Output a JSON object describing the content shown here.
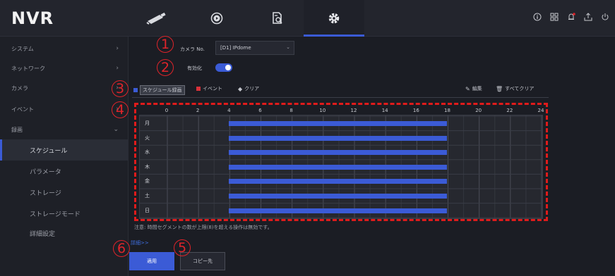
{
  "app": {
    "logo": "NVR"
  },
  "nav": {
    "tabs": [
      {
        "icon": "camera-icon"
      },
      {
        "icon": "playback-icon"
      },
      {
        "icon": "file-search-icon"
      },
      {
        "icon": "settings-gear-icon",
        "active": true
      }
    ],
    "right_icons": [
      "info-icon",
      "network-icon",
      "alarm-bell-icon",
      "export-icon",
      "power-icon"
    ]
  },
  "sidebar": {
    "items": [
      {
        "label": "システム",
        "chevron": "›"
      },
      {
        "label": "ネットワーク",
        "chevron": "›"
      },
      {
        "label": "カメラ",
        "chevron": "›"
      },
      {
        "label": "イベント",
        "chevron": "›"
      },
      {
        "label": "録画",
        "chevron": "⌄"
      }
    ],
    "subitems": [
      {
        "label": "スケジュール",
        "active": true
      },
      {
        "label": "パラメータ"
      },
      {
        "label": "ストレージ"
      },
      {
        "label": "ストレージモード"
      },
      {
        "label": "詳細設定"
      }
    ]
  },
  "form": {
    "camera_label": "カメラ No.",
    "camera_value": "[D1] IPdome",
    "camera_caret": "⌄",
    "enable_label": "有効化",
    "enabled": true
  },
  "toolbar": {
    "schedule_label": "スケジュール録画",
    "event_label": "イベント",
    "clear_label": "クリア",
    "edit_label": "編集",
    "clear_all_label": "すべてクリア",
    "schedule_color": "#3b5bd6",
    "event_color": "#d8313a"
  },
  "chart_data": {
    "type": "table",
    "hour_ticks": [
      "0",
      "2",
      "4",
      "6",
      "8",
      "10",
      "12",
      "14",
      "16",
      "18",
      "20",
      "22",
      "24"
    ],
    "days": [
      "月",
      "火",
      "水",
      "木",
      "金",
      "土",
      "日"
    ],
    "schedules": [
      {
        "day": "月",
        "start": 4,
        "end": 18,
        "type": "schedule"
      },
      {
        "day": "火",
        "start": 4,
        "end": 18,
        "type": "schedule"
      },
      {
        "day": "水",
        "start": 4,
        "end": 18,
        "type": "schedule"
      },
      {
        "day": "木",
        "start": 4,
        "end": 18,
        "type": "schedule"
      },
      {
        "day": "金",
        "start": 4,
        "end": 18,
        "type": "schedule"
      },
      {
        "day": "土",
        "start": 4,
        "end": 18,
        "type": "schedule"
      },
      {
        "day": "日",
        "start": 4,
        "end": 18,
        "type": "schedule"
      }
    ]
  },
  "note": "注意: 時間セグメントの数が上限(8)を超える操作は無効です。",
  "advanced_link": "詳細>>",
  "buttons": {
    "apply": "適用",
    "copy": "コピー先"
  },
  "annotations": [
    "1",
    "2",
    "3",
    "4",
    "5",
    "6"
  ],
  "colors": {
    "accent": "#3b5bd6",
    "annotation": "#e0242a"
  }
}
